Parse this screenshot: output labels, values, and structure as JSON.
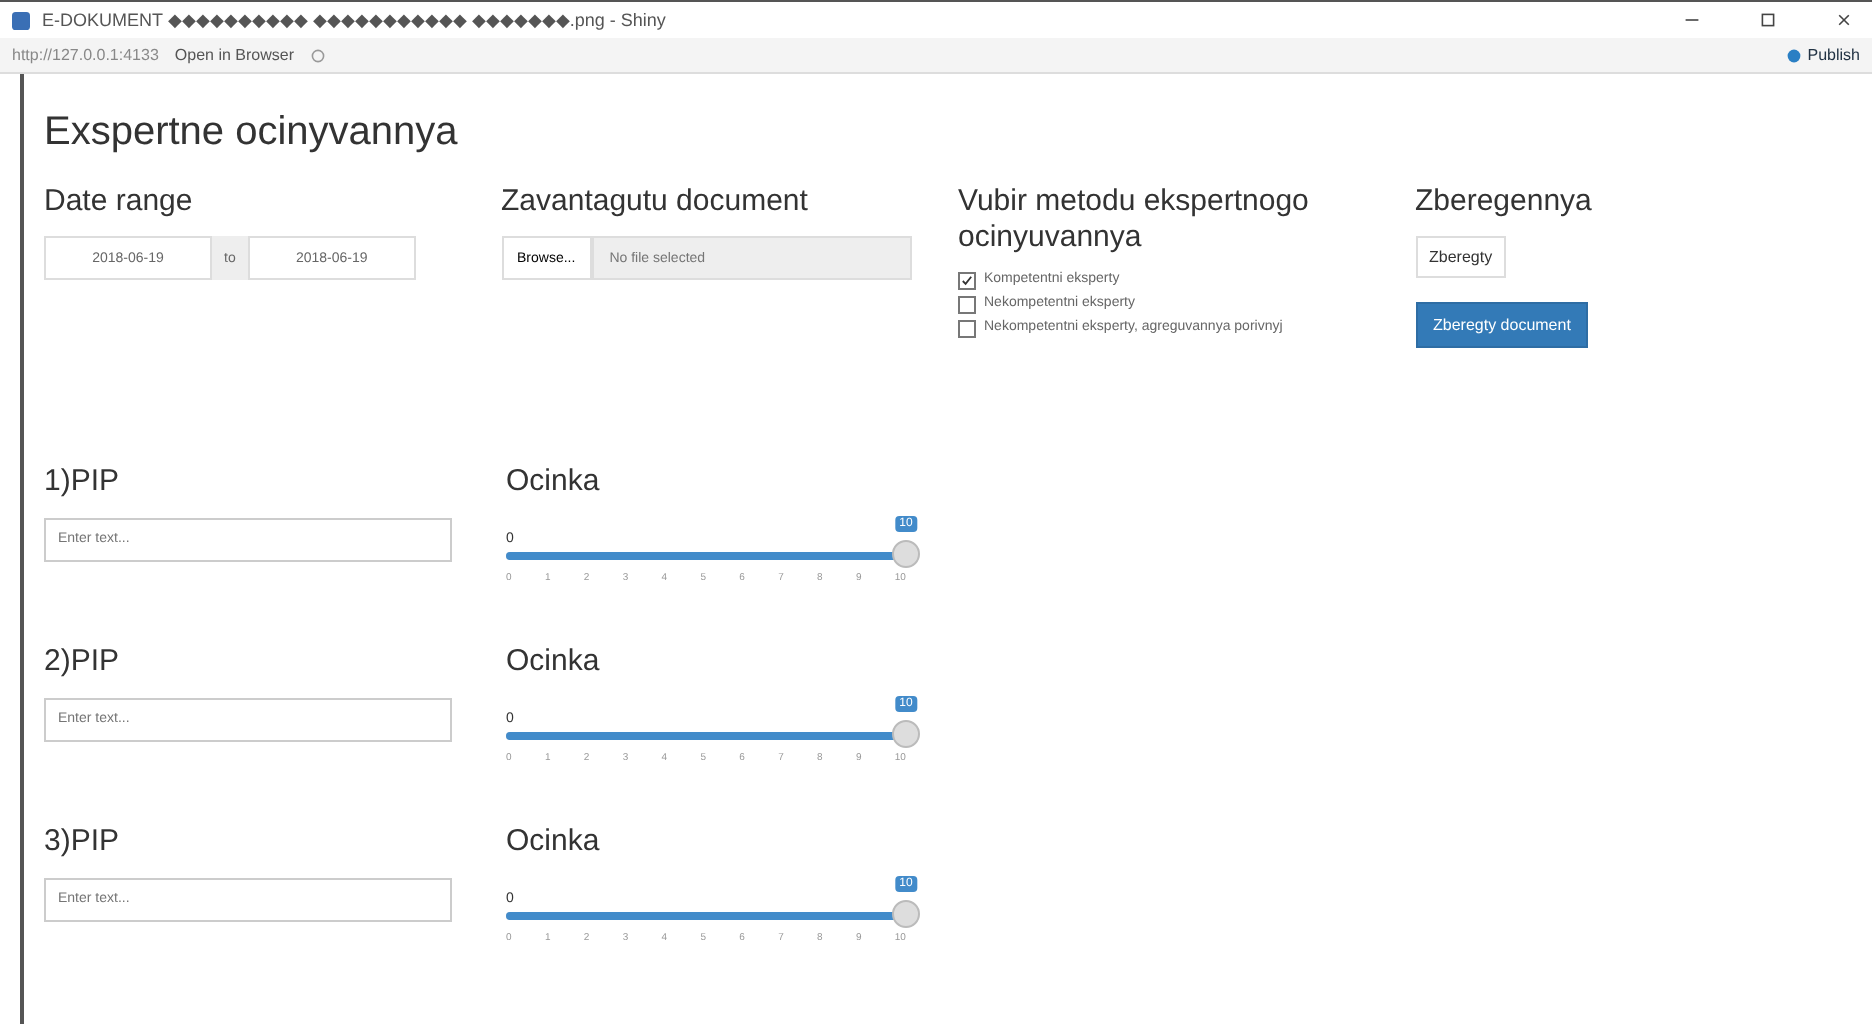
{
  "window": {
    "title": "E-DOKUMENT ◆◆◆◆◆◆◆◆◆◆ ◆◆◆◆◆◆◆◆◆◆◆ ◆◆◆◆◆◆◆.png - Shiny",
    "address": "http://127.0.0.1:4133",
    "open_button": "Open in Browser",
    "publish_button": "Publish"
  },
  "page_title": "Exspertne ocinyvannya",
  "date_range": {
    "label": "Date range",
    "start": "2018-06-19",
    "separator": "to",
    "end": "2018-06-19"
  },
  "upload": {
    "label": "Zavantagutu document",
    "button": "Browse...",
    "placeholder": "No file selected"
  },
  "method": {
    "label": "Vubir metodu ekspertnogo ocinyuvannya",
    "options": [
      {
        "label": "Kompetentni eksperty",
        "checked": true
      },
      {
        "label": "Nekompetentni eksperty",
        "checked": false
      },
      {
        "label": "Nekompetentni eksperty, agreguvannya porivnyj",
        "checked": false
      }
    ]
  },
  "save": {
    "label": "Zberegennya",
    "button": "Zberegty",
    "primary_button": "Zberegty document"
  },
  "rows": [
    {
      "label": "1)PIP",
      "placeholder": "Enter text...",
      "slider_label": "Ocinka",
      "min": "0",
      "value": "10",
      "level": 1,
      "ticks": [
        "0",
        "1",
        "2",
        "3",
        "4",
        "5",
        "6",
        "7",
        "8",
        "9",
        "10"
      ]
    },
    {
      "label": "2)PIP",
      "placeholder": "Enter text...",
      "slider_label": "Ocinka",
      "min": "0",
      "value": "10",
      "level": 1,
      "ticks": [
        "0",
        "1",
        "2",
        "3",
        "4",
        "5",
        "6",
        "7",
        "8",
        "9",
        "10"
      ]
    },
    {
      "label": "3)PIP",
      "placeholder": "Enter text...",
      "slider_label": "Ocinka",
      "min": "0",
      "value": "10",
      "level": 1,
      "ticks": [
        "0",
        "1",
        "2",
        "3",
        "4",
        "5",
        "6",
        "7",
        "8",
        "9",
        "10"
      ]
    }
  ]
}
